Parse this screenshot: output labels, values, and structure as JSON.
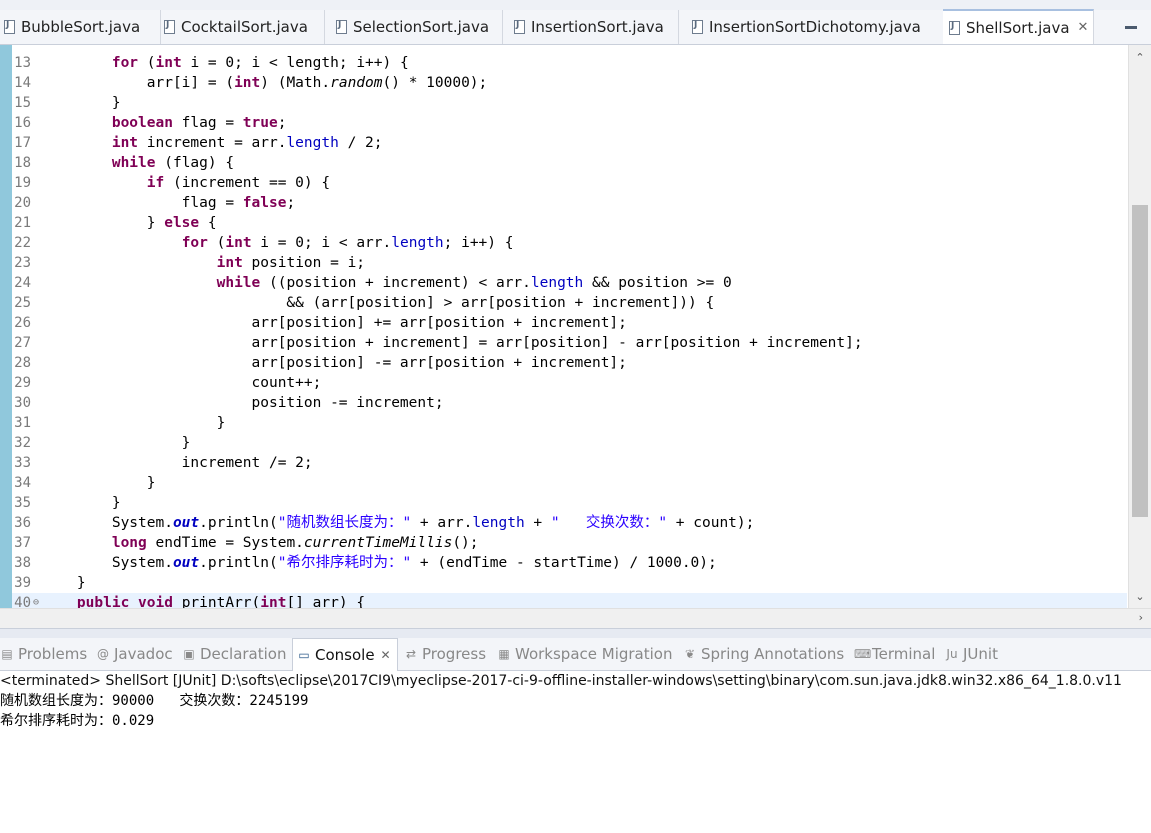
{
  "tabs": [
    {
      "label": "BubbleSort.java"
    },
    {
      "label": "CocktailSort.java"
    },
    {
      "label": "SelectionSort.java"
    },
    {
      "label": "InsertionSort.java"
    },
    {
      "label": "InsertionSortDichotomy.java"
    },
    {
      "label": "ShellSort.java",
      "close": "✕"
    }
  ],
  "editor": {
    "line_numbers": [
      "13",
      "14",
      "15",
      "16",
      "17",
      "18",
      "19",
      "20",
      "21",
      "22",
      "23",
      "24",
      "25",
      "26",
      "27",
      "28",
      "29",
      "30",
      "31",
      "32",
      "33",
      "34",
      "35",
      "36",
      "37",
      "38",
      "39",
      "40"
    ]
  },
  "views": [
    {
      "label": "Problems",
      "icon": "problems-icon"
    },
    {
      "label": "Javadoc",
      "icon": "javadoc-icon"
    },
    {
      "label": "Declaration",
      "icon": "declaration-icon"
    },
    {
      "label": "Console",
      "icon": "console-icon",
      "close": "✕"
    },
    {
      "label": "Progress",
      "icon": "progress-icon"
    },
    {
      "label": "Workspace Migration",
      "icon": "workspace-migration-icon"
    },
    {
      "label": "Spring Annotations",
      "icon": "spring-annotations-icon"
    },
    {
      "label": "Terminal",
      "icon": "terminal-icon"
    },
    {
      "label": "JUnit",
      "icon": "junit-icon"
    }
  ],
  "console": {
    "header": "<terminated> ShellSort [JUnit] D:\\softs\\eclipse\\2017CI9\\myeclipse-2017-ci-9-offline-installer-windows\\setting\\binary\\com.sun.java.jdk8.win32.x86_64_1.8.0.v11",
    "lines": [
      "随机数组长度为：90000   交换次数：2245199",
      "希尔排序耗时为：0.029"
    ]
  },
  "colors": {
    "keyword": "#7f0055",
    "field": "#0000c0",
    "string": "#2a00ff",
    "gutter": "#90c8dc"
  }
}
